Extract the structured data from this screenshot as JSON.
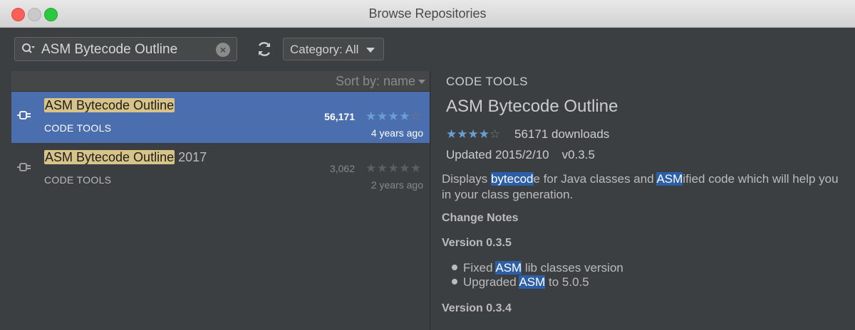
{
  "window": {
    "title": "Browse Repositories"
  },
  "toolbar": {
    "search_value": "ASM Bytecode Outline",
    "category_label": "Category: All"
  },
  "list": {
    "sort_label": "Sort by: name",
    "items": [
      {
        "name_match": "ASM Bytecode Outline",
        "name_rest": "",
        "category": "CODE TOOLS",
        "downloads": "56,171",
        "rating": 4,
        "age": "4 years ago",
        "selected": true
      },
      {
        "name_match": "ASM Bytecode Outline",
        "name_rest": " 2017",
        "category": "CODE TOOLS",
        "downloads": "3,062",
        "rating": 0,
        "age": "2 years ago",
        "selected": false
      }
    ]
  },
  "detail": {
    "category": "CODE TOOLS",
    "name": "ASM Bytecode Outline",
    "rating": 4,
    "downloads_text": "56171 downloads",
    "updated": "Updated 2015/2/10",
    "version": "v0.3.5",
    "desc_1": "Displays ",
    "desc_hl1": "bytecod",
    "desc_2": "e for Java classes and ",
    "desc_hl2": "ASM",
    "desc_3": "ified code which will help you in your class generation.",
    "change_notes_heading": "Change Notes",
    "version_heading_1": "Version 0.3.5",
    "notes": [
      {
        "pre": "Fixed ",
        "hl": "ASM",
        "post": " lib classes version"
      },
      {
        "pre": "Upgraded ",
        "hl": "ASM",
        "post": " to 5.0.5"
      }
    ],
    "version_heading_2": "Version 0.3.4"
  },
  "colors": {
    "selection": "#4b6eaf",
    "match_highlight": "#d8c388",
    "text_highlight": "#2d5ea8",
    "star_filled": "#6a9fd4",
    "star_empty": "#7a7a7a"
  }
}
